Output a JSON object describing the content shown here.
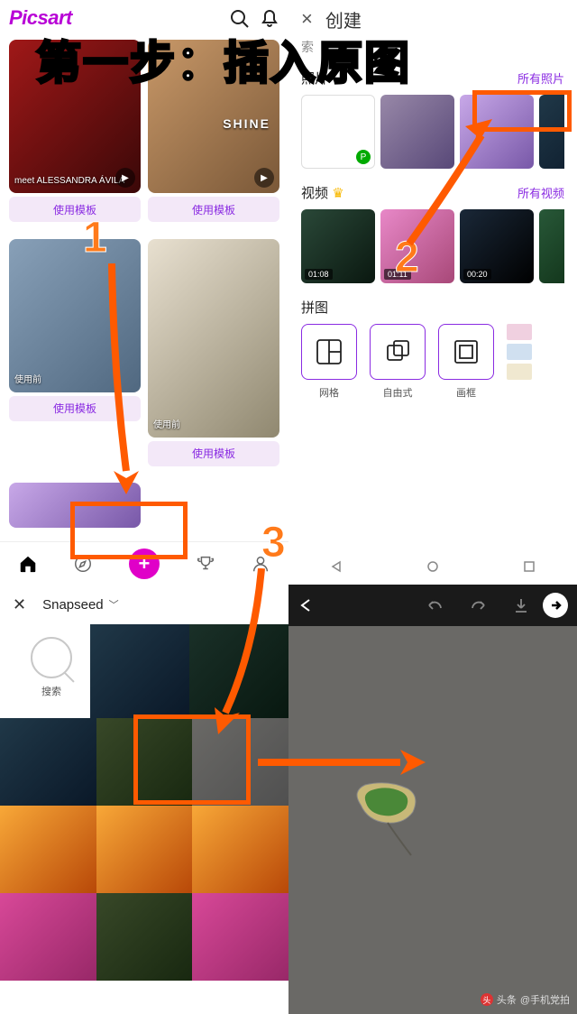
{
  "tutorial": {
    "title": "第一步：插入原图",
    "steps": [
      "1",
      "2",
      "3"
    ],
    "watermark_label": "头条",
    "watermark_user": "@手机党拍"
  },
  "picsart": {
    "logo": "Picsart",
    "cards": [
      {
        "caption": "meet\nALESSANDRA\nÁVILA",
        "btn": "使用模板"
      },
      {
        "caption": "SHINE",
        "btn": "使用模板"
      },
      {
        "caption": "使用前",
        "btn": "使用模板"
      },
      {
        "caption": "使用前",
        "btn": "使用模板"
      }
    ]
  },
  "create": {
    "title": "创建",
    "search_placeholder": "索",
    "sections": {
      "photos": {
        "head": "照片",
        "all": "所有照片"
      },
      "videos": {
        "head": "视频",
        "all": "所有视频",
        "durations": [
          "01:08",
          "01:11",
          "00:20"
        ]
      },
      "collage": {
        "head": "拼图",
        "items": [
          "网格",
          "自由式",
          "画框"
        ]
      }
    }
  },
  "snapseed": {
    "title": "Snapseed",
    "search": "搜索"
  }
}
